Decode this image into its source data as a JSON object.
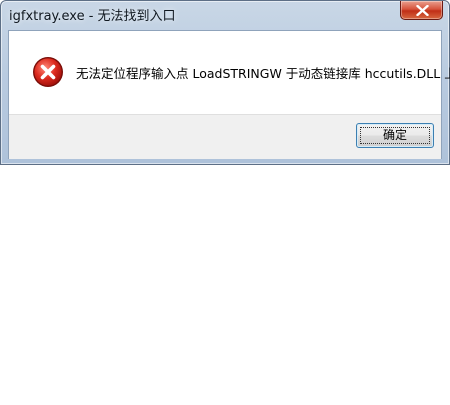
{
  "window": {
    "title": "igfxtray.exe - 无法找到入口",
    "close_icon": "close-x-icon"
  },
  "message": {
    "icon": "error-icon",
    "text": "无法定位程序输入点 LoadSTRINGW 于动态链接库 hccutils.DLL 上。"
  },
  "buttons": {
    "ok_label": "确定"
  },
  "colors": {
    "close_button": "#c9452c",
    "error_icon_fill": "#d81e1e",
    "button_focus_border": "#3c7fb1"
  }
}
